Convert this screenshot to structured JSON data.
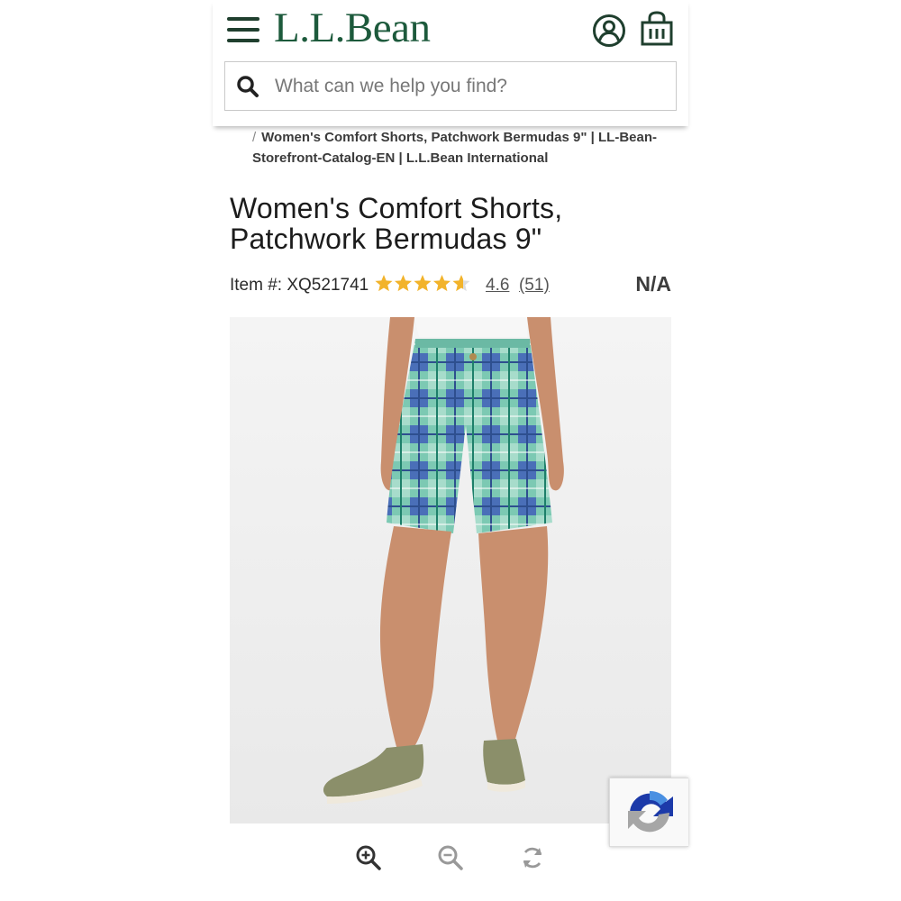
{
  "header": {
    "logo_text": "L.L.Bean",
    "brand_color": "#1d5a3c",
    "icons": [
      "menu-icon",
      "account-icon",
      "shopping-bag-icon"
    ]
  },
  "search": {
    "placeholder": "What can we help you find?",
    "value": ""
  },
  "breadcrumb": {
    "separator": "/",
    "current": "Women's Comfort Shorts, Patchwork Bermudas 9\" | LL-Bean-Storefront-Catalog-EN | L.L.Bean International"
  },
  "product": {
    "title": "Women's Comfort Shorts, Patchwork Bermudas 9\"",
    "item_number": "Item #: XQ521741",
    "rating_value": "4.6",
    "rating_count": "(51)",
    "rating_stars_fraction": 0.92,
    "star_color": "#f2b32b",
    "price": "N/A"
  },
  "image_controls": {
    "icons": [
      "zoom-in-icon",
      "zoom-out-icon",
      "rotate-icon"
    ]
  },
  "recaptcha": {
    "icon": "recaptcha-icon"
  }
}
